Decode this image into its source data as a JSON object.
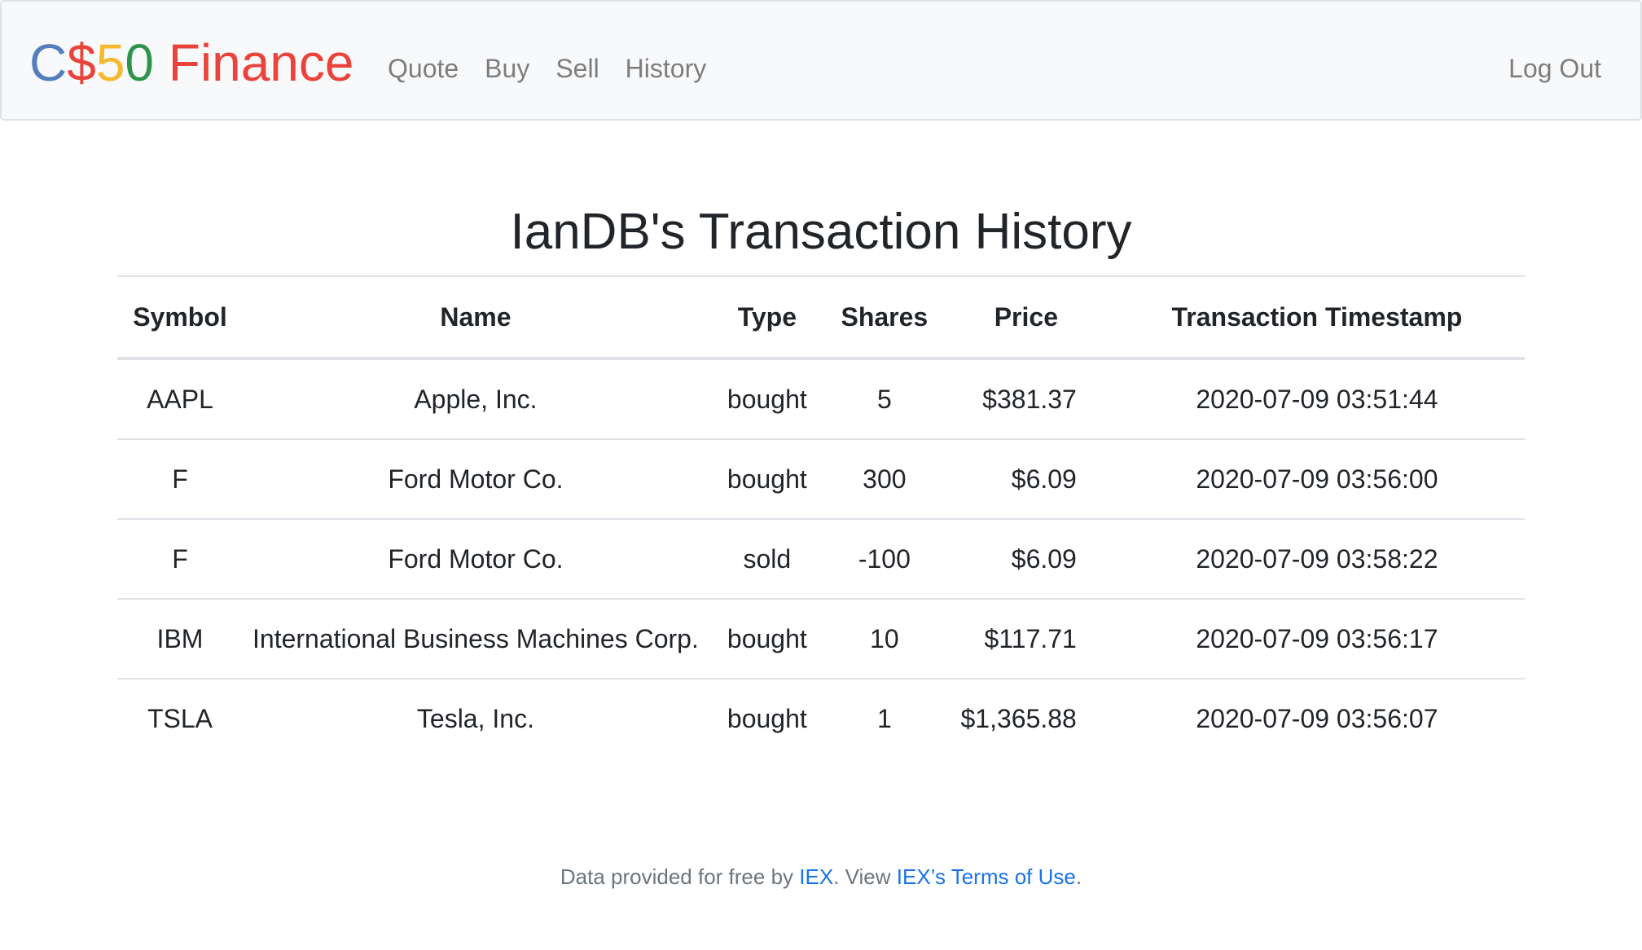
{
  "brand": {
    "parts": [
      {
        "text": "C",
        "color": "#537fbe"
      },
      {
        "text": "$",
        "color": "#ea433b"
      },
      {
        "text": "5",
        "color": "#f5b82e"
      },
      {
        "text": "0",
        "color": "#2e944b"
      },
      {
        "text": " Finance",
        "color": "#ea433b"
      }
    ]
  },
  "nav": {
    "items": [
      "Quote",
      "Buy",
      "Sell",
      "History"
    ],
    "logout": "Log Out"
  },
  "page": {
    "title": "IanDB's Transaction History"
  },
  "table": {
    "headers": [
      "Symbol",
      "Name",
      "Type",
      "Shares",
      "Price",
      "Transaction Timestamp"
    ],
    "rows": [
      {
        "symbol": "AAPL",
        "name": "Apple, Inc.",
        "type": "bought",
        "shares": "5",
        "price": "$381.37",
        "timestamp": "2020-07-09 03:51:44"
      },
      {
        "symbol": "F",
        "name": "Ford Motor Co.",
        "type": "bought",
        "shares": "300",
        "price": "$6.09",
        "timestamp": "2020-07-09 03:56:00"
      },
      {
        "symbol": "F",
        "name": "Ford Motor Co.",
        "type": "sold",
        "shares": "-100",
        "price": "$6.09",
        "timestamp": "2020-07-09 03:58:22"
      },
      {
        "symbol": "IBM",
        "name": "International Business Machines Corp.",
        "type": "bought",
        "shares": "10",
        "price": "$117.71",
        "timestamp": "2020-07-09 03:56:17"
      },
      {
        "symbol": "TSLA",
        "name": "Tesla, Inc.",
        "type": "bought",
        "shares": "1",
        "price": "$1,365.88",
        "timestamp": "2020-07-09 03:56:07"
      }
    ]
  },
  "footer": {
    "prefix": "Data provided for free by ",
    "link1": "IEX",
    "middle": ". View ",
    "link2": "IEX’s Terms of Use",
    "suffix": "."
  },
  "colors": {
    "navbar_bg": "#f8f9fa",
    "link": "#1a73e8",
    "text": "#212529"
  }
}
